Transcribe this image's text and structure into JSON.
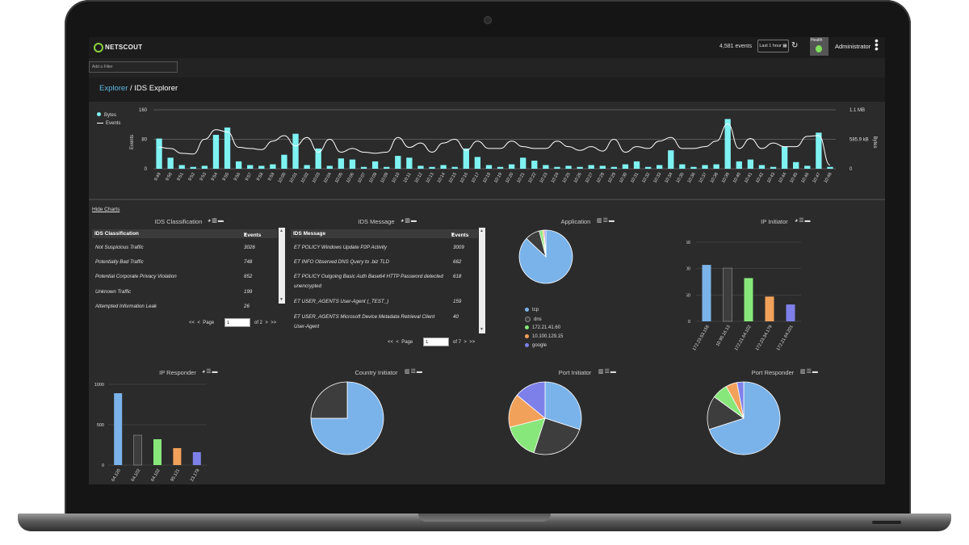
{
  "app": {
    "logo": "NETSCOUT",
    "events_count": "4,581 events",
    "time_range": "Last 1 hour",
    "health_label": "Health",
    "user": "Administrator"
  },
  "filter": {
    "placeholder": "Add a Filter"
  },
  "breadcrumb": {
    "parent": "Explorer",
    "separator": " / ",
    "current": "IDS Explorer"
  },
  "colors": {
    "bytes": "#7ff2f2",
    "blue": "#7ab3ea",
    "dark": "#3d3d3d",
    "green": "#88e77a",
    "orange": "#f2a15a",
    "purple": "#7e80ea",
    "accent": "#5fb8e8"
  },
  "chart_data": [
    {
      "type": "bar",
      "title": "",
      "xlabel": "",
      "ylabel": "Events",
      "y2label": "Bytes",
      "ylim": [
        0,
        160
      ],
      "yticks": [
        "160",
        "80",
        "0"
      ],
      "y2ticks": [
        "1.1 MB",
        "585.9 kB",
        "0"
      ],
      "legend": [
        "Bytes",
        "Events"
      ],
      "legend_position": "top-left",
      "categories": [
        "9:49",
        "9:50",
        "9:51",
        "9:52",
        "9:53",
        "9:54",
        "9:55",
        "9:56",
        "9:57",
        "9:58",
        "9:59",
        "10:00",
        "10:01",
        "10:02",
        "10:03",
        "10:04",
        "10:05",
        "10:06",
        "10:07",
        "10:08",
        "10:09",
        "10:10",
        "10:11",
        "10:12",
        "10:13",
        "10:14",
        "10:15",
        "10:16",
        "10:17",
        "10:18",
        "10:19",
        "10:20",
        "10:21",
        "10:22",
        "10:23",
        "10:24",
        "10:25",
        "10:26",
        "10:27",
        "10:28",
        "10:29",
        "10:30",
        "10:31",
        "10:32",
        "10:33",
        "10:34",
        "10:35",
        "10:36",
        "10:37",
        "10:38",
        "10:39",
        "10:40",
        "10:41",
        "10:42",
        "10:43",
        "10:44",
        "10:45",
        "10:46",
        "10:47",
        "10:48"
      ],
      "series": [
        {
          "name": "Bytes",
          "values": [
            82,
            30,
            10,
            5,
            8,
            92,
            112,
            20,
            10,
            8,
            12,
            38,
            95,
            10,
            55,
            8,
            28,
            25,
            5,
            20,
            5,
            35,
            30,
            8,
            5,
            10,
            5,
            55,
            32,
            10,
            5,
            12,
            30,
            22,
            10,
            5,
            8,
            5,
            10,
            8,
            5,
            12,
            20,
            5,
            10,
            50,
            12,
            5,
            10,
            12,
            135,
            20,
            25,
            10,
            5,
            60,
            18,
            8,
            98,
            5
          ]
        },
        {
          "name": "Events",
          "values": [
            58,
            55,
            42,
            40,
            80,
            106,
            100,
            58,
            55,
            52,
            75,
            90,
            62,
            85,
            45,
            80,
            45,
            55,
            45,
            42,
            45,
            85,
            58,
            70,
            45,
            70,
            80,
            50,
            75,
            55,
            55,
            75,
            60,
            55,
            55,
            75,
            60,
            50,
            60,
            48,
            80,
            45,
            60,
            55,
            75,
            85,
            55,
            55,
            60,
            75,
            122,
            55,
            82,
            55,
            70,
            60,
            60,
            88,
            90,
            10
          ]
        }
      ]
    },
    {
      "type": "bar",
      "title": "IP Initiator",
      "ylim": [
        0,
        750
      ],
      "yticks": [
        "750",
        "500",
        "250",
        "0"
      ],
      "categories": [
        "172.23.53.158",
        "10.90.16.13",
        "172.21.64.102",
        "172.23.34.179",
        "172.21.64.201"
      ],
      "values": [
        535,
        505,
        410,
        235,
        160
      ]
    },
    {
      "type": "pie",
      "title": "Application",
      "categories": [
        "tcp",
        "dns",
        "172.21.41.60",
        "10.100.129.15",
        "google"
      ],
      "values": [
        87,
        9,
        2,
        1,
        1
      ]
    },
    {
      "type": "bar",
      "title": "IP Responder",
      "ylim": [
        0,
        1000
      ],
      "yticks": [
        "1000",
        "500",
        "0"
      ],
      "categories": [
        "64.120",
        "64.102",
        "64.102",
        "95.121",
        "23.178"
      ],
      "values": [
        890,
        370,
        320,
        210,
        160
      ]
    },
    {
      "type": "pie",
      "title": "Country Initiator",
      "categories": [
        "",
        ""
      ],
      "values": [
        75,
        25
      ]
    },
    {
      "type": "pie",
      "title": "Port Initiator",
      "categories": [
        "",
        "",
        "",
        "",
        ""
      ],
      "values": [
        30,
        25,
        16,
        15,
        14
      ]
    },
    {
      "type": "pie",
      "title": "Port Responder",
      "categories": [
        "",
        "",
        "",
        "",
        ""
      ],
      "values": [
        70,
        15,
        7,
        5,
        3
      ]
    }
  ],
  "panels": {
    "hide_charts": "Hide Charts",
    "ids_classification": {
      "title": "IDS Classification",
      "col1": "IDS Classification",
      "col2": "Events",
      "rows": [
        {
          "name": "Not Suspicious Traffic",
          "events": "3026"
        },
        {
          "name": "Potentially Bad Traffic",
          "events": "748"
        },
        {
          "name": "Potential Corporate Privacy Violation",
          "events": "652"
        },
        {
          "name": "Unknown Traffic",
          "events": "199"
        },
        {
          "name": "Attempted Information Leak",
          "events": "26"
        }
      ],
      "pager": {
        "first": "<<",
        "prev": "<",
        "label": "Page",
        "value": "1",
        "of": "of 2",
        "next": ">",
        "last": ">>"
      }
    },
    "ids_message": {
      "title": "IDS Message",
      "col1": "IDS Message",
      "col2": "Events",
      "rows": [
        {
          "l1": "ET POLICY Windows Update P2P Activity",
          "l2": "",
          "events": "3009"
        },
        {
          "l1": "ET INFO Observed DNS Query to .biz TLD",
          "l2": "",
          "events": "662"
        },
        {
          "l1": "ET POLICY Outgoing Basic Auth Base64 HTTP Password detected",
          "l2": "unencrypted",
          "events": "618"
        },
        {
          "l1": "ET USER_AGENTS User-Agent (_TEST_)",
          "l2": "",
          "events": "159"
        },
        {
          "l1": "ET USER_AGENTS Microsoft Device Metadata Retrieval Client",
          "l2": "User-Agent",
          "events": "40"
        }
      ],
      "pager": {
        "first": "<<",
        "prev": "<",
        "label": "Page",
        "value": "1",
        "of": "of 7",
        "next": ">",
        "last": ">>"
      }
    },
    "application": {
      "title": "Application"
    },
    "ip_initiator": {
      "title": "IP Initiator"
    },
    "ip_responder": {
      "title": "IP Responder"
    },
    "country_initiator": {
      "title": "Country Initiator"
    },
    "port_initiator": {
      "title": "Port Initiator"
    },
    "port_responder": {
      "title": "Port Responder"
    }
  },
  "icons": {
    "pie": "pie-chart-icon",
    "bar": "bar-chart-icon",
    "list": "list-icon",
    "trash": "trash-icon",
    "refresh": "refresh-icon",
    "calendar": "calendar-icon",
    "kebab": "kebab-menu-icon"
  }
}
